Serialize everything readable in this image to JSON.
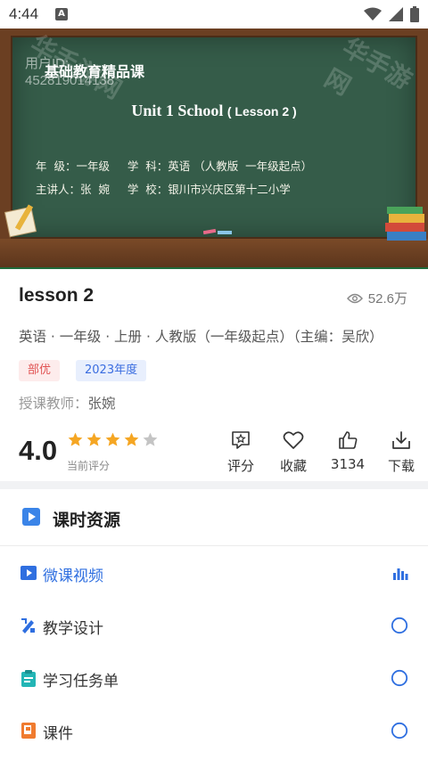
{
  "status": {
    "time": "4:44",
    "notification_icon": "A"
  },
  "video": {
    "watermark_user_label": "用户ID:",
    "watermark_user_id": "452819014138",
    "board_title": "基础教育精品课",
    "unit_title": "Unit 1 School",
    "unit_lesson": "( Lesson 2 )",
    "info_line1": "年  级：一年级     学  科：英语 （人教版  一年级起点）",
    "info_line2": "主讲人：张  婉     学  校：银川市兴庆区第十二小学",
    "site_watermark": "华手游网"
  },
  "course": {
    "title": "lesson 2",
    "views": "52.6万",
    "subtitle": "英语 · 一年级 · 上册 · 人教版（一年级起点）（主编：吴欣）",
    "tags": [
      "部优",
      "2023年度"
    ],
    "teacher_label": "授课教师：",
    "teacher_name": "张婉"
  },
  "rating": {
    "score": "4.0",
    "stars_filled": 4,
    "stars_total": 5,
    "caption": "当前评分"
  },
  "actions": [
    {
      "label": "评分",
      "icon": "rate-icon"
    },
    {
      "label": "收藏",
      "icon": "heart-icon"
    },
    {
      "label": "3134",
      "icon": "thumbs-up-icon"
    },
    {
      "label": "下载",
      "icon": "download-icon"
    }
  ],
  "resources": {
    "heading": "课时资源",
    "items": [
      {
        "label": "微课视频",
        "icon": "video-icon",
        "state": "playing"
      },
      {
        "label": "教学设计",
        "icon": "design-icon",
        "state": "unchecked"
      },
      {
        "label": "学习任务单",
        "icon": "clipboard-icon",
        "state": "unchecked"
      },
      {
        "label": "课件",
        "icon": "ppt-icon",
        "state": "unchecked"
      }
    ]
  },
  "colors": {
    "accent": "#2f6fe0",
    "star": "#f5a623",
    "board": "#355c49",
    "tag_red": "#e05252"
  }
}
